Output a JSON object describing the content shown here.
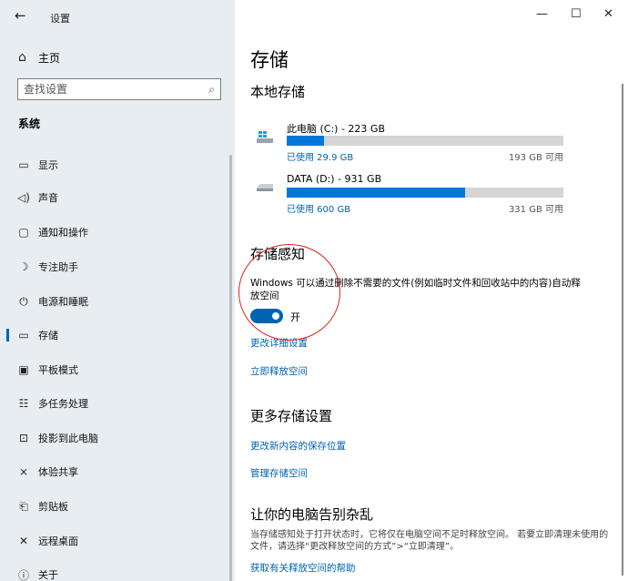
{
  "window": {
    "title": "设置",
    "back_glyph": "←",
    "minimize_glyph": "—",
    "maximize_glyph": "☐",
    "close_glyph": "✕"
  },
  "sidebar": {
    "home_label": "主页",
    "search_placeholder": "查找设置",
    "section_label": "系统",
    "items": [
      {
        "label": "显示",
        "icon": "monitor-icon",
        "glyph": "▭"
      },
      {
        "label": "声音",
        "icon": "speaker-icon",
        "glyph": "◁)"
      },
      {
        "label": "通知和操作",
        "icon": "notification-icon",
        "glyph": "▢"
      },
      {
        "label": "专注助手",
        "icon": "moon-icon",
        "glyph": "☽"
      },
      {
        "label": "电源和睡眠",
        "icon": "power-icon",
        "glyph": "⏻"
      },
      {
        "label": "存储",
        "icon": "storage-icon",
        "glyph": "▭",
        "selected": true
      },
      {
        "label": "平板模式",
        "icon": "tablet-icon",
        "glyph": "▣"
      },
      {
        "label": "多任务处理",
        "icon": "multitask-icon",
        "glyph": "☷"
      },
      {
        "label": "投影到此电脑",
        "icon": "project-icon",
        "glyph": "⊡"
      },
      {
        "label": "体验共享",
        "icon": "share-icon",
        "glyph": "⨯"
      },
      {
        "label": "剪贴板",
        "icon": "clipboard-icon",
        "glyph": "⎗"
      },
      {
        "label": "远程桌面",
        "icon": "remote-icon",
        "glyph": "✕"
      },
      {
        "label": "关于",
        "icon": "info-icon",
        "glyph": "ⓘ"
      }
    ]
  },
  "main": {
    "page_title": "存储",
    "local_storage_heading": "本地存储",
    "drives": [
      {
        "name": "此电脑 (C:) - 223 GB",
        "used": "已使用 29.9 GB",
        "free": "193 GB 可用",
        "used_fraction": 0.134,
        "icon": "windows-drive-icon"
      },
      {
        "name": "DATA (D:) - 931 GB",
        "used": "已使用 600 GB",
        "free": "331 GB 可用",
        "used_fraction": 0.644,
        "icon": "hard-drive-icon"
      }
    ],
    "storage_sense_heading": "存储感知",
    "storage_sense_desc": "Windows 可以通过删除不需要的文件(例如临时文件和回收站中的内容)自动释放空间",
    "toggle_label": "开",
    "toggle_on": true,
    "link_change_settings": "更改详细设置",
    "link_free_now": "立即释放空间",
    "more_heading": "更多存储设置",
    "link_change_save_location": "更改新内容的保存位置",
    "link_manage_spaces": "管理存储空间",
    "declutter_heading": "让你的电脑告别杂乱",
    "declutter_note": "当存储感知处于打开状态时，它将仅在电脑空间不足时释放空间。 若要立即清理未使用的文件，请选择“更改释放空间的方式”>“立即清理”。",
    "link_help": "获取有关释放空间的帮助"
  },
  "colors": {
    "accent": "#0063b1",
    "bar_fill": "#0078d7",
    "annotation": "#e2231a"
  }
}
